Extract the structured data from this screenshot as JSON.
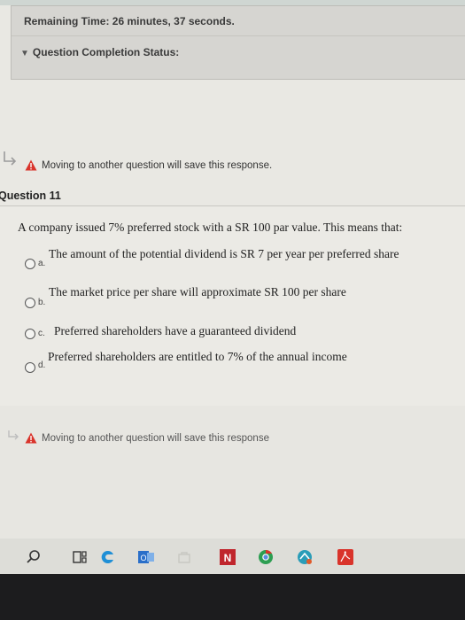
{
  "timer": {
    "text": "Remaining Time: 26 minutes, 37 seconds."
  },
  "completion_status": {
    "label": "Question Completion Status:"
  },
  "warning": {
    "text": "Moving to another question will save this response."
  },
  "question": {
    "header": "Question 11",
    "text": "A company issued 7% preferred stock with a SR 100 par value. This means that:",
    "options": [
      {
        "letter": "a.",
        "text": "The amount of the potential dividend is SR 7 per year per preferred share"
      },
      {
        "letter": "b.",
        "text": "The market price per share will approximate SR 100 per share"
      },
      {
        "letter": "c.",
        "text": "Preferred shareholders have a guaranteed dividend"
      },
      {
        "letter": "d.",
        "text": "Preferred shareholders are entitled to 7% of the annual income"
      }
    ]
  },
  "warning_bottom": {
    "text": "Moving to another question will save this response"
  },
  "taskbar": {
    "icons": [
      "search-icon",
      "task-view-icon",
      "edge-icon",
      "outlook-icon",
      "store-icon",
      "netflix-icon",
      "chrome-icon",
      "app-icon",
      "acrobat-icon"
    ],
    "colors": {
      "edge": "#1f8fd6",
      "outlook": "#2a6fc9",
      "netflix": "#c0262d",
      "chrome": "#2d9e52",
      "acrobat": "#d9342b"
    }
  },
  "colors": {
    "warning_triangle": "#d9342b",
    "panel_bg": "#d6d5d1"
  }
}
